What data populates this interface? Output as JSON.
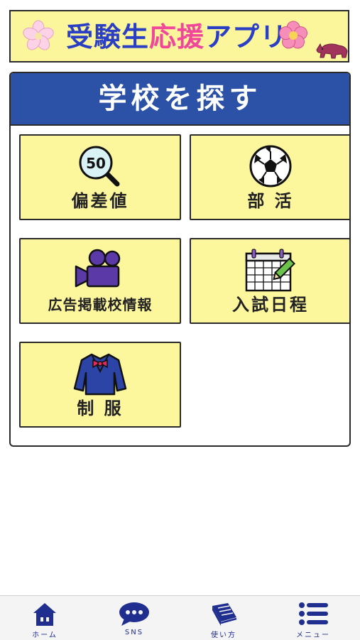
{
  "header": {
    "title_part1": "受験生",
    "title_part2": "応援",
    "title_part3": "アプリ"
  },
  "panel": {
    "title": "学校を探す",
    "tiles": [
      {
        "label": "偏差値",
        "icon": "magnifier-50-icon",
        "badge": "50"
      },
      {
        "label": "部 活",
        "icon": "soccer-ball-icon"
      },
      {
        "label": "広告掲載校情報",
        "icon": "video-camera-icon"
      },
      {
        "label": "入試日程",
        "icon": "calendar-pencil-icon"
      },
      {
        "label": "制 服",
        "icon": "school-uniform-icon"
      }
    ]
  },
  "tabbar": {
    "items": [
      {
        "label": "ホーム",
        "icon": "home-icon"
      },
      {
        "label": "SNS",
        "icon": "chat-bubble-icon"
      },
      {
        "label": "使い方",
        "icon": "book-icon"
      },
      {
        "label": "メニュー",
        "icon": "menu-list-icon"
      }
    ]
  },
  "colors": {
    "banner_bg": "#fbf59b",
    "header_blue": "#2b52a6",
    "tile_yellow": "#fcf69c",
    "accent_pink": "#f0479b",
    "title_blue": "#2b3fc4",
    "tab_navy": "#1f2e8f"
  }
}
